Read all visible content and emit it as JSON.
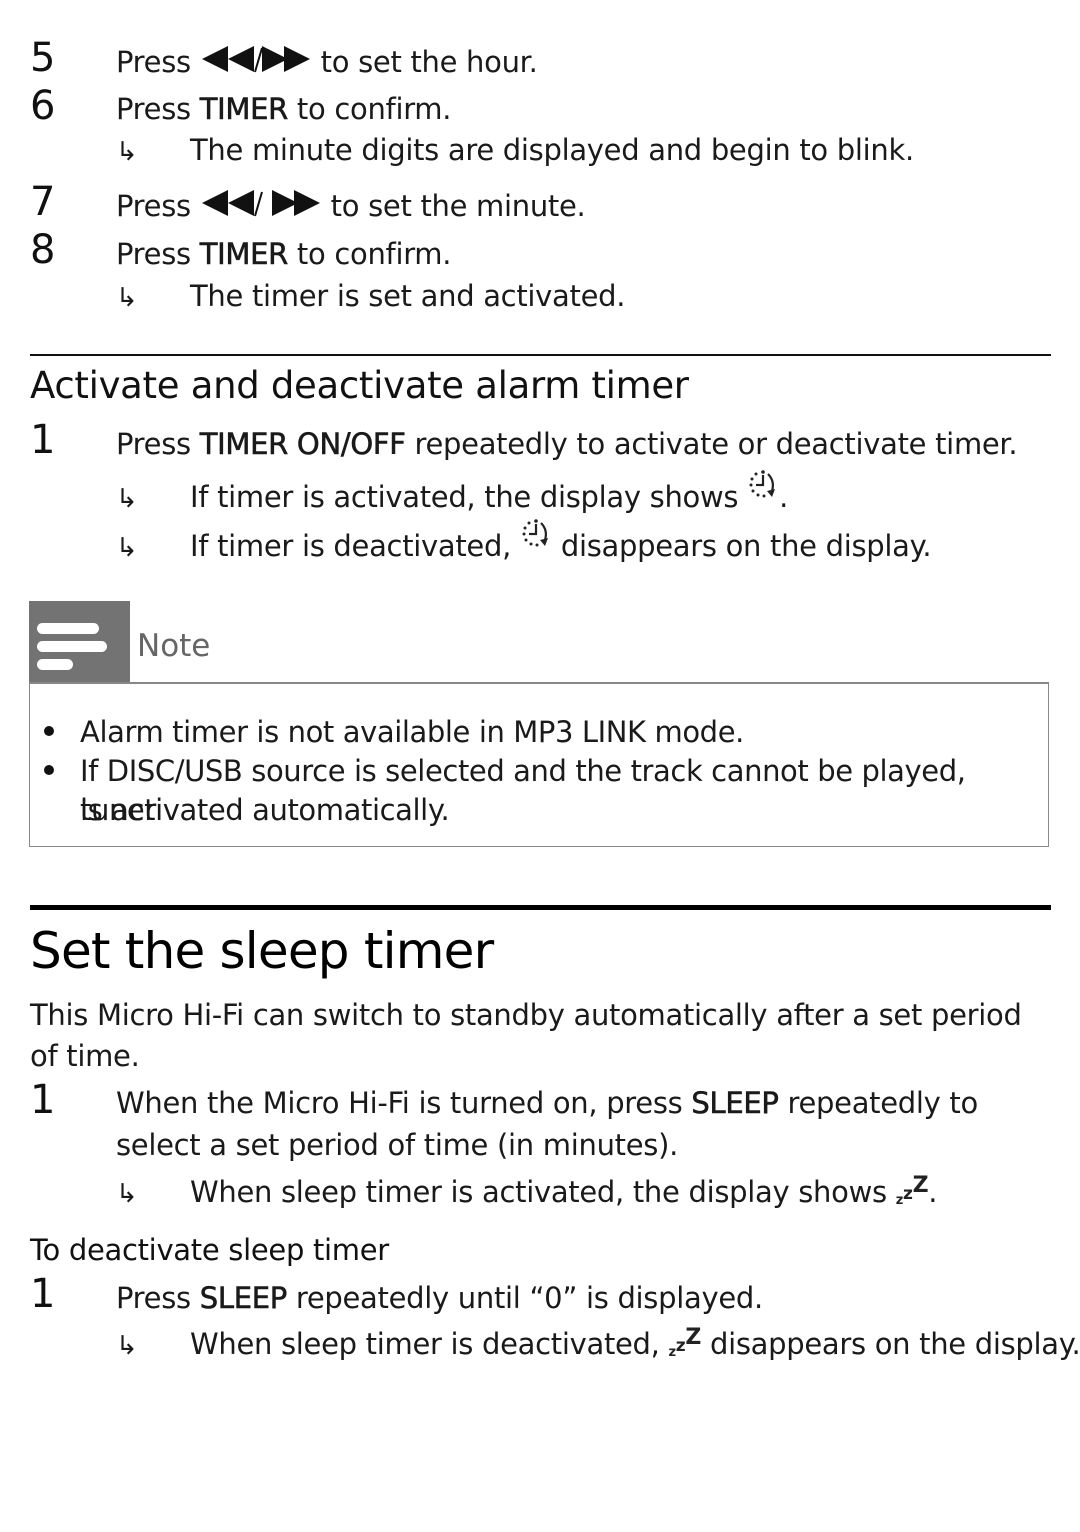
{
  "steps_top": [
    {
      "number": "5",
      "prefix": "Press ",
      "icon": "prev-next-icon",
      "separator": "/",
      "suffix": " to set the hour."
    },
    {
      "number": "6",
      "prefix": "Press ",
      "bold": "TIMER",
      "suffix": " to confirm.",
      "result": "The minute digits are displayed and begin to blink."
    },
    {
      "number": "7",
      "prefix": "Press ",
      "icon": "prev-next-icon",
      "separator": "/ ",
      "suffix": " to set the minute."
    },
    {
      "number": "8",
      "prefix": "Press ",
      "bold": "TIMER",
      "suffix": " to confirm.",
      "result": "The timer is set and activated."
    }
  ],
  "alarm_section": {
    "heading": "Activate and deactivate alarm timer",
    "step": {
      "number": "1",
      "prefix": "Press ",
      "bold": "TIMER ON/OFF",
      "suffix": " repeatedly to activate or deactivate timer."
    },
    "results": [
      {
        "before": "If timer is activated, the display shows ",
        "after": "."
      },
      {
        "before": "If timer is deactivated, ",
        "after": " disappears on the display."
      }
    ]
  },
  "note": {
    "title": "Note",
    "items": [
      "Alarm timer is not available in MP3 LINK mode.",
      "If DISC/USB source is selected and the track cannot be played, tuner",
      "is activated automatically."
    ]
  },
  "sleep_section": {
    "heading": "Set the sleep timer",
    "intro_line1": "This Micro Hi-Fi can switch to standby automatically after a set period",
    "intro_line2": "of time.",
    "step": {
      "number": "1",
      "prefix": "When the Micro Hi-Fi is turned on, press ",
      "bold": "SLEEP",
      "suffix": " repeatedly to",
      "line2": "select a set period of time (in minutes)."
    },
    "result": {
      "before": "When sleep timer is activated, the display shows ",
      "after": "."
    },
    "subheading": "To deactivate sleep timer",
    "deactivate_step": {
      "number": "1",
      "prefix": "Press ",
      "bold": "SLEEP",
      "suffix": " repeatedly until “0” is displayed."
    },
    "deactivate_result": {
      "before": "When sleep timer is deactivated, ",
      "after": " disappears on the display."
    }
  },
  "symbols": {
    "arrow": "↳",
    "zzz": [
      "z",
      "z",
      "Z"
    ]
  }
}
